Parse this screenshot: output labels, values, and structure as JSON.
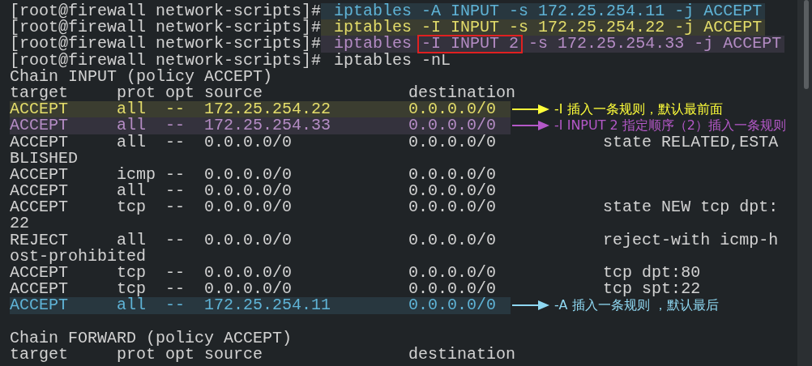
{
  "lines": [
    {
      "kind": "prompt",
      "prompt": "[root@firewall network-scripts]#",
      "color": "#5fb3d6",
      "command": [
        {
          "text": "iptables -A INPUT -s 172.25.254.11 -j ACCEPT",
          "boxed": false
        }
      ]
    },
    {
      "kind": "prompt",
      "prompt": "[root@firewall network-scripts]#",
      "color": "#e3dc6a",
      "command": [
        {
          "text": "iptables -I INPUT -s 172.25.254.22 -j ACCEPT",
          "boxed": false
        }
      ]
    },
    {
      "kind": "prompt",
      "prompt": "[root@firewall network-scripts]#",
      "color": "#b48cc4",
      "command": [
        {
          "text": "iptables",
          "boxed": false
        },
        {
          "text": "-I INPUT 2",
          "boxed": true
        },
        {
          "text": "-s 172.25.254.33 -j ACCEPT",
          "boxed": false
        }
      ]
    },
    {
      "kind": "prompt",
      "prompt": "[root@firewall network-scripts]#",
      "command": [
        {
          "text": "iptables -nL",
          "boxed": false
        }
      ]
    },
    {
      "kind": "text",
      "text": "Chain INPUT (policy ACCEPT)"
    },
    {
      "kind": "row",
      "cells": [
        "target",
        "prot",
        "opt",
        "source",
        "destination"
      ]
    },
    {
      "kind": "row",
      "cells": [
        "ACCEPT",
        "all",
        "--",
        "172.25.254.22",
        "0.0.0.0/0"
      ],
      "color": "#e3dc6a",
      "annotation": {
        "text": "-I 插入一条规则，默认最前面",
        "color": "#ffff3a"
      }
    },
    {
      "kind": "row",
      "cells": [
        "ACCEPT",
        "all",
        "--",
        "172.25.254.33",
        "0.0.0.0/0"
      ],
      "color": "#b48cc4",
      "annotation": {
        "text": "-I INPUT 2 指定顺序（2）插入一条规则",
        "color": "#b458c8"
      }
    },
    {
      "kind": "row",
      "cells": [
        "ACCEPT",
        "all",
        "--",
        "0.0.0.0/0",
        "0.0.0.0/0"
      ],
      "extra": "state RELATED,ESTA"
    },
    {
      "kind": "text",
      "text": "BLISHED"
    },
    {
      "kind": "row",
      "cells": [
        "ACCEPT",
        "icmp",
        "--",
        "0.0.0.0/0",
        "0.0.0.0/0"
      ]
    },
    {
      "kind": "row",
      "cells": [
        "ACCEPT",
        "all",
        "--",
        "0.0.0.0/0",
        "0.0.0.0/0"
      ]
    },
    {
      "kind": "row",
      "cells": [
        "ACCEPT",
        "tcp",
        "--",
        "0.0.0.0/0",
        "0.0.0.0/0"
      ],
      "extra": "state NEW tcp dpt:"
    },
    {
      "kind": "text",
      "text": "22"
    },
    {
      "kind": "row",
      "cells": [
        "REJECT",
        "all",
        "--",
        "0.0.0.0/0",
        "0.0.0.0/0"
      ],
      "extra": "reject-with icmp-h"
    },
    {
      "kind": "text",
      "text": "ost-prohibited"
    },
    {
      "kind": "row",
      "cells": [
        "ACCEPT",
        "tcp",
        "--",
        "0.0.0.0/0",
        "0.0.0.0/0"
      ],
      "extra": "tcp dpt:80"
    },
    {
      "kind": "row",
      "cells": [
        "ACCEPT",
        "tcp",
        "--",
        "0.0.0.0/0",
        "0.0.0.0/0"
      ],
      "extra": "tcp spt:22"
    },
    {
      "kind": "row",
      "cells": [
        "ACCEPT",
        "all",
        "--",
        "172.25.254.11",
        "0.0.0.0/0"
      ],
      "color": "#5fb3d6",
      "annotation": {
        "text": "-A 插入一条规则 ，默认最后",
        "color": "#8fd8f2"
      }
    },
    {
      "kind": "blank"
    },
    {
      "kind": "text",
      "text": "Chain FORWARD (policy ACCEPT)"
    },
    {
      "kind": "row",
      "cells": [
        "target",
        "prot",
        "opt",
        "source",
        "destination"
      ]
    }
  ]
}
